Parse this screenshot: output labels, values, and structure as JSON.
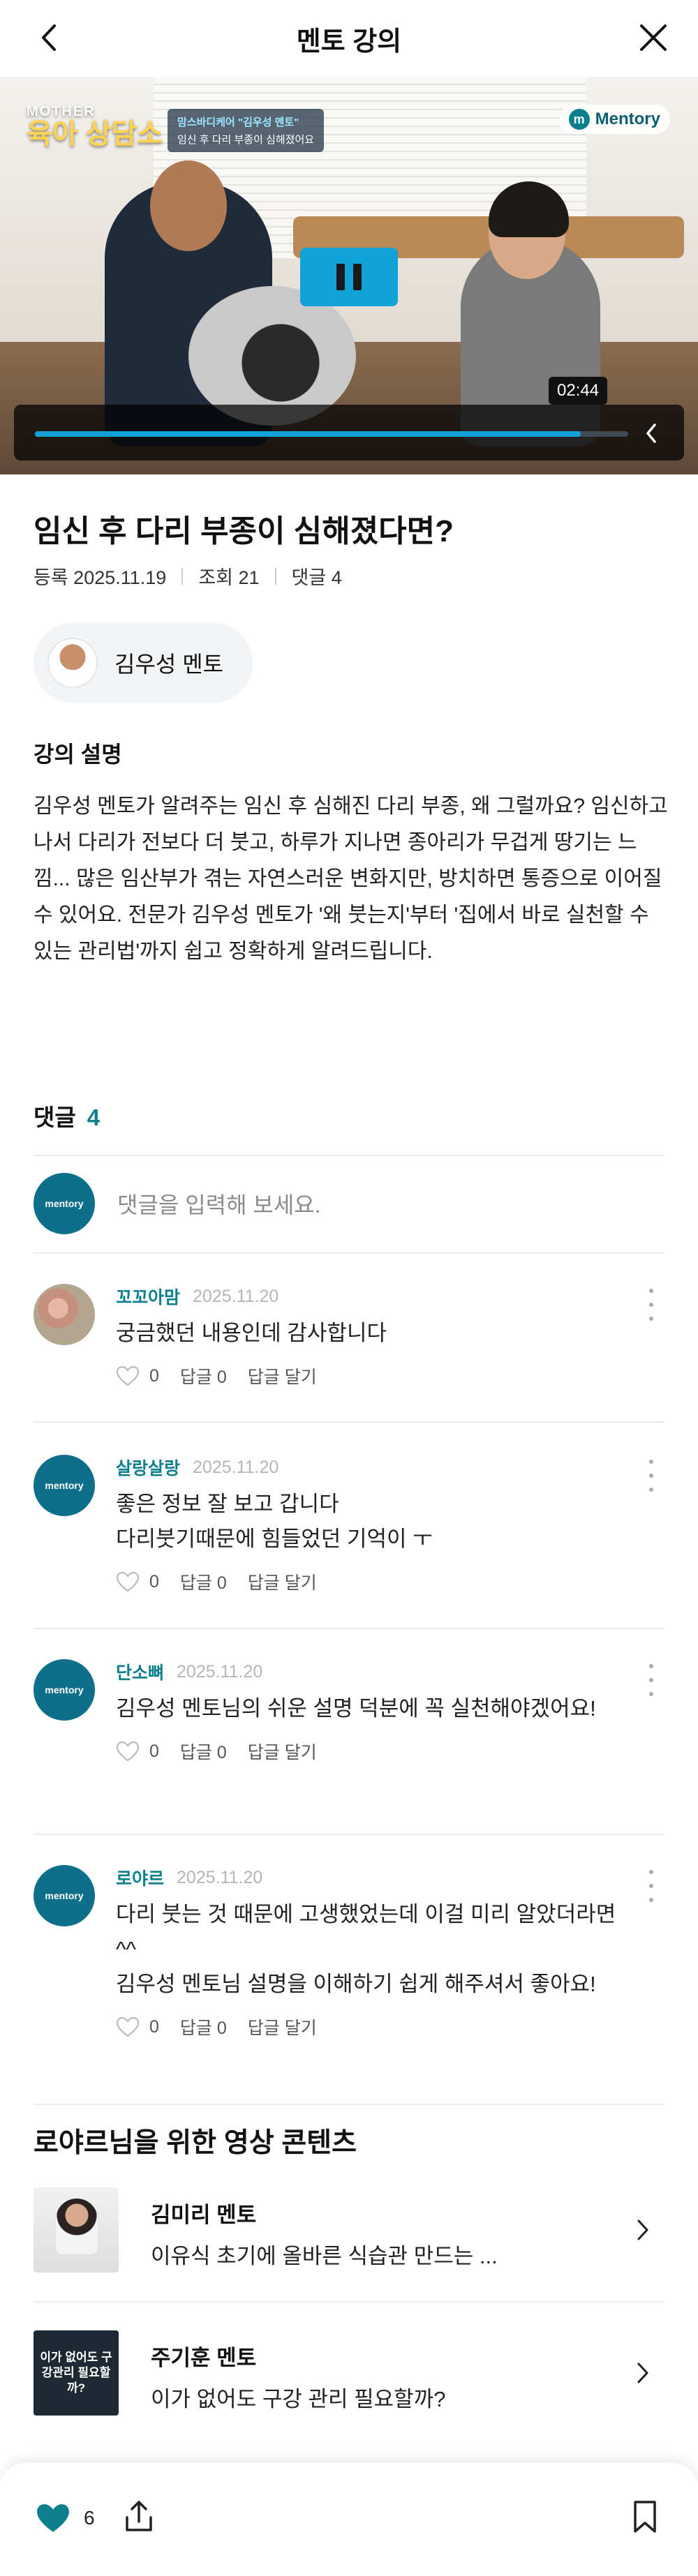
{
  "header": {
    "title": "멘토 강의"
  },
  "video": {
    "show_small": "MOTHER",
    "show_title": "육아 상담소",
    "caption_line1": "맘스바디케어 \"김우성 멘토\"",
    "caption_line2": "임신 후 다리 부종이 심해졌어요",
    "brand": "Mentory",
    "brand_mark": "m",
    "current_time": "02:44",
    "progress_fraction": 0.92,
    "accent_color": "#12a2d8"
  },
  "lecture": {
    "title": "임신 후 다리 부종이 심해졌다면?",
    "registered": "등록 2025.11.19",
    "views": "조회 21",
    "comments": "댓글 4",
    "mentor_name": "김우성 멘토"
  },
  "description": {
    "heading": "강의 설명",
    "text": "김우성 멘토가 알려주는 임신 후 심해진 다리 부종, 왜 그럴까요? 임신하고 나서 다리가 전보다 더 붓고, 하루가 지나면 종아리가 무겁게 땅기는 느낌... 많은 임산부가 겪는 자연스러운 변화지만, 방치하면 통증으로 이어질 수 있어요. 전문가 김우성 멘토가 '왜 붓는지'부터 '집에서 바로 실천할 수 있는 관리법'까지 쉽고 정확하게 알려드립니다."
  },
  "comments": {
    "heading": "댓글",
    "count": "4",
    "input_placeholder": "댓글을 입력해 보세요.",
    "avatar_label": "mentory",
    "items": [
      {
        "nick": "꼬꼬아맘",
        "date": "2025.11.20",
        "text": "궁금했던 내용인데 감사합니다",
        "likes": "0",
        "replies": "답글 0",
        "reply_action": "답글 달기"
      },
      {
        "nick": "살랑살랑",
        "date": "2025.11.20",
        "text": "좋은 정보 잘 보고 갑니다\n다리붓기때문에 힘들었던 기억이 ㅜ",
        "likes": "0",
        "replies": "답글 0",
        "reply_action": "답글 달기"
      },
      {
        "nick": "단소뼈",
        "date": "2025.11.20",
        "text": "김우성 멘토님의 쉬운 설명 덕분에 꼭 실천해야겠어요!",
        "likes": "0",
        "replies": "답글 0",
        "reply_action": "답글 달기"
      },
      {
        "nick": "로야르",
        "date": "2025.11.20",
        "text": "다리 붓는 것 때문에 고생했었는데 이걸 미리 알았더라면^^\n김우성 멘토님 설명을 이해하기 쉽게 해주셔서 좋아요!",
        "likes": "0",
        "replies": "답글 0",
        "reply_action": "답글 달기"
      }
    ]
  },
  "recommend": {
    "heading": "로야르님을 위한 영상 콘텐츠",
    "items": [
      {
        "mentor": "김미리 멘토",
        "lecture": "이유식 초기에 올바른 식습관 만드는 ..."
      },
      {
        "mentor": "주기훈 멘토",
        "lecture": "이가 없어도 구강 관리 필요할까?",
        "thumb_text": "이가 없어도 구강관리 필요할까?"
      }
    ]
  },
  "bottombar": {
    "like_count": "6",
    "like_color": "#0b7f8c"
  }
}
